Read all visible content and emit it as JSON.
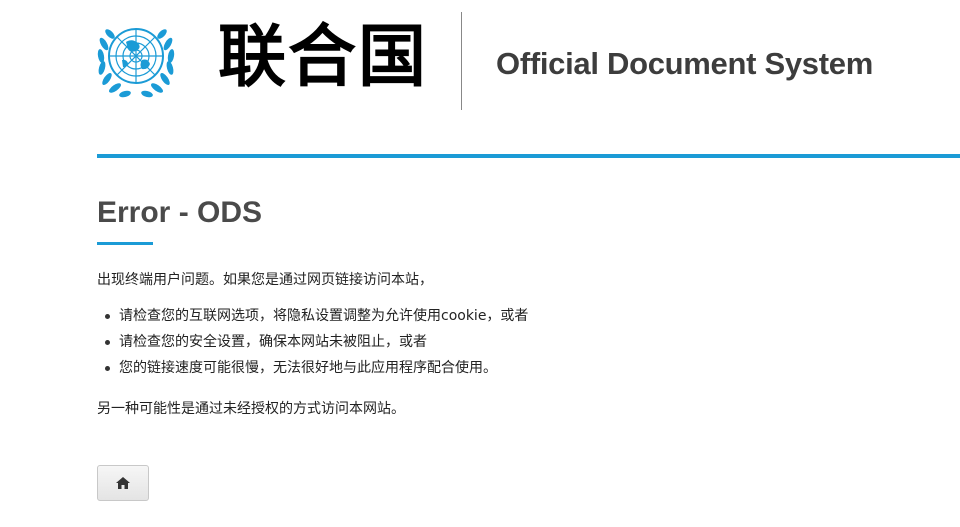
{
  "header": {
    "logo_text": "联合国",
    "site_title": "Official Document System"
  },
  "page": {
    "title": "Error - ODS",
    "intro": "出现终端用户问题。如果您是通过网页链接访问本站，",
    "reasons": [
      {
        "text": "请检查您的互联网选项，将隐私设置调整为允许使用cookie，或者"
      },
      {
        "text": "请检查您的安全设置，确保本网站未被阻止，或者"
      },
      {
        "text": "您的链接速度可能很慢，无法很好地与此应用程序配合使用。"
      }
    ],
    "alternative": "另一种可能性是通过未经授权的方式访问本网站。"
  },
  "home_button": {
    "icon": "home-icon"
  },
  "colors": {
    "accent": "#1b9bd6",
    "emblem": "#1b9bd6",
    "title": "#4a4a4a"
  }
}
